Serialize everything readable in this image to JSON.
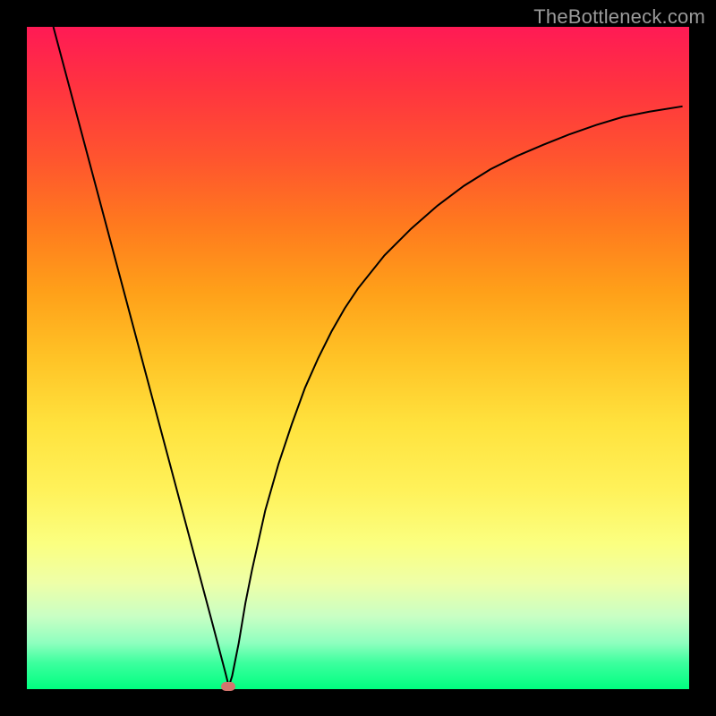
{
  "watermark": "TheBottleneck.com",
  "chart_data": {
    "type": "line",
    "title": "",
    "xlabel": "",
    "ylabel": "",
    "xlim": [
      0,
      100
    ],
    "ylim": [
      0,
      100
    ],
    "x": [
      4,
      6,
      8,
      10,
      12,
      14,
      16,
      18,
      20,
      22,
      24,
      26,
      28,
      29,
      30,
      30.5,
      31,
      32,
      33,
      34,
      36,
      38,
      40,
      42,
      44,
      46,
      48,
      50,
      54,
      58,
      62,
      66,
      70,
      74,
      78,
      82,
      86,
      90,
      94,
      99
    ],
    "y": [
      100,
      92.5,
      85,
      77.5,
      70,
      62.5,
      55,
      47.5,
      40,
      32.5,
      25,
      17.5,
      10,
      6.2,
      2.4,
      0.4,
      2,
      7,
      13,
      18,
      27,
      34,
      40,
      45.5,
      50,
      54,
      57.5,
      60.5,
      65.5,
      69.5,
      73,
      76,
      78.5,
      80.5,
      82.2,
      83.8,
      85.2,
      86.4,
      87.2,
      88
    ],
    "marker": {
      "x": 30.4,
      "y": 0.4
    },
    "background_gradient": {
      "top": "#ff1a55",
      "bottom": "#00ff80"
    }
  }
}
